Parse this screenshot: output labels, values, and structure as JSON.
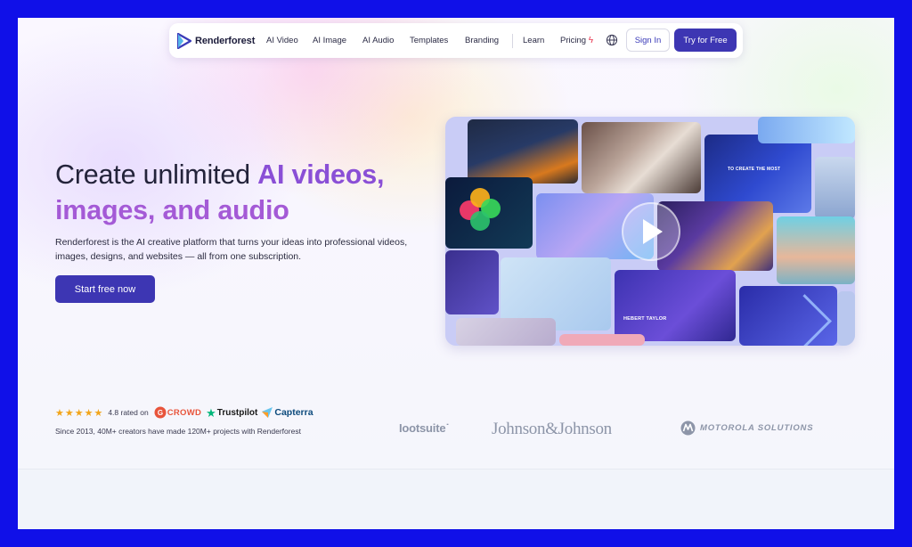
{
  "nav": {
    "brand": "Renderforest",
    "items": [
      "AI Video",
      "AI Image",
      "AI Audio",
      "Templates",
      "Branding",
      "Learn",
      "Pricing"
    ],
    "pricing_icon": "bolt-icon",
    "language_icon": "globe-icon",
    "sign_in": "Sign In",
    "try_free": "Try for Free"
  },
  "hero": {
    "title_part1": "Create unlimited ",
    "title_accent1": "AI videos,",
    "title_accent2": "images, and audio",
    "subtitle": "Renderforest is the AI creative platform that turns your ideas into professional videos, images, designs, and websites — all from one subscription.",
    "cta": "Start free now"
  },
  "mosaic": {
    "play_icon": "play-icon",
    "tile_text_1": "TO CREATE THE MOST",
    "tile_text_2": "HEBERT TAYLOR"
  },
  "rating": {
    "stars": "★★★★★",
    "score_text": "4.8 rated on",
    "g2_crowd": "CROWD",
    "trustpilot": "Trustpilot",
    "capterra": "Capterra",
    "since": "Since 2013, 40M+ creators have made 120M+ projects with Renderforest"
  },
  "brands": {
    "hootsuite": "Iootsuite˙",
    "jnj": "Johnson&Johnson",
    "motorola": "MOTOROLA SOLUTIONS"
  },
  "colors": {
    "accent": "#3d36b3",
    "title_accent": "#8a4fd6",
    "frame": "#1010e8"
  }
}
